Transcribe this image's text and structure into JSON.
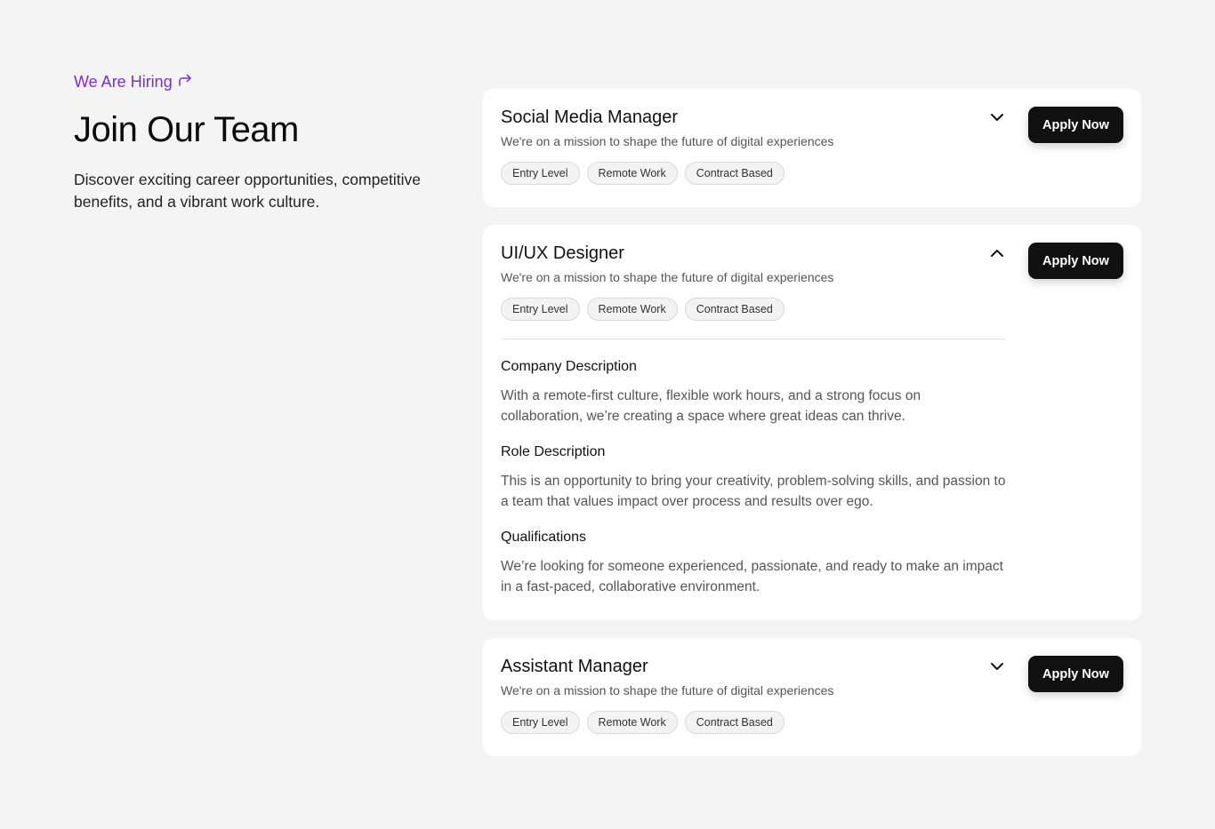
{
  "intro": {
    "eyebrow": "We Are Hiring",
    "title": "Join Our Team",
    "subtitle": "Discover exciting career opportunities, competitive benefits, and a vibrant work culture."
  },
  "colors": {
    "accent": "#7b2fd0",
    "button_bg": "#111111",
    "page_bg": "#f4f4f4"
  },
  "jobs": [
    {
      "title": "Social Media Manager",
      "tagline": "We're on a mission to shape the future of digital experiences",
      "tags": [
        "Entry Level",
        "Remote Work",
        "Contract Based"
      ],
      "apply_label": "Apply Now",
      "expanded": false,
      "toggle_icon": "chevron-down-icon"
    },
    {
      "title": "UI/UX Designer",
      "tagline": "We're on a mission to shape the future of digital experiences",
      "tags": [
        "Entry Level",
        "Remote Work",
        "Contract Based"
      ],
      "apply_label": "Apply Now",
      "expanded": true,
      "toggle_icon": "chevron-up-icon",
      "sections": [
        {
          "heading": "Company Description",
          "body": "With a remote-first culture, flexible work hours, and a strong focus on collaboration, we’re creating a space where great ideas can thrive."
        },
        {
          "heading": "Role Description",
          "body": "This is an opportunity to bring your creativity, problem-solving skills, and passion to a team that values impact over process and results over ego."
        },
        {
          "heading": "Qualifications",
          "body": "We’re looking for someone experienced, passionate, and ready to make an impact in a fast-paced, collaborative environment."
        }
      ]
    },
    {
      "title": "Assistant Manager",
      "tagline": "We're on a mission to shape the future of digital experiences",
      "tags": [
        "Entry Level",
        "Remote Work",
        "Contract Based"
      ],
      "apply_label": "Apply Now",
      "expanded": false,
      "toggle_icon": "chevron-down-icon"
    }
  ]
}
